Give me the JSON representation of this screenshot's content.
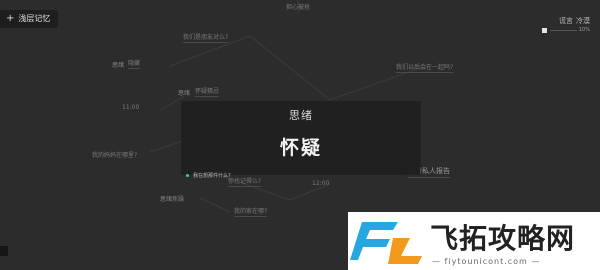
{
  "header": {
    "title": "浅层记忆"
  },
  "top_right": {
    "labels": [
      "谎言",
      "冷漠"
    ],
    "progress_text": "10%"
  },
  "modal": {
    "subtitle": "思绪",
    "title": "怀疑"
  },
  "option": {
    "label": "我在想那件什么?"
  },
  "map_nodes": [
    {
      "text": "担心被抢",
      "kind": "normal"
    },
    {
      "text": "我们是朋友对么?",
      "kind": "normal"
    },
    {
      "text": "思绪",
      "kind": "tag"
    },
    {
      "text": "隐藏",
      "kind": "normal"
    },
    {
      "text": "思绪",
      "kind": "tag"
    },
    {
      "text": "怀疑猜忌",
      "kind": "normal"
    },
    {
      "text": "11:00",
      "kind": "normal"
    },
    {
      "text": "我的妈妈在哪里?",
      "kind": "normal"
    },
    {
      "text": "我们以后会在一起吗?",
      "kind": "normal"
    },
    {
      "text": "一份私人报告",
      "kind": "bright"
    },
    {
      "text": "12:00",
      "kind": "normal"
    },
    {
      "text": "你也记得么?",
      "kind": "normal"
    },
    {
      "text": "思绪",
      "kind": "tag"
    },
    {
      "text": "焦躁",
      "kind": "normal"
    },
    {
      "text": "我的家在哪?",
      "kind": "normal"
    }
  ],
  "watermark": {
    "cn": "飞拓攻略网",
    "url": "— fiytounicont.com —"
  },
  "icons": {
    "plus": "plus-icon",
    "status_dot": "status-dot-icon",
    "logo": "watermark-logo-icon"
  },
  "colors": {
    "background": "#2c2c2c",
    "modal": "#202020",
    "accent_green": "#4ccf63",
    "logo_blue": "#27a7e0",
    "logo_orange": "#f39a1e"
  }
}
